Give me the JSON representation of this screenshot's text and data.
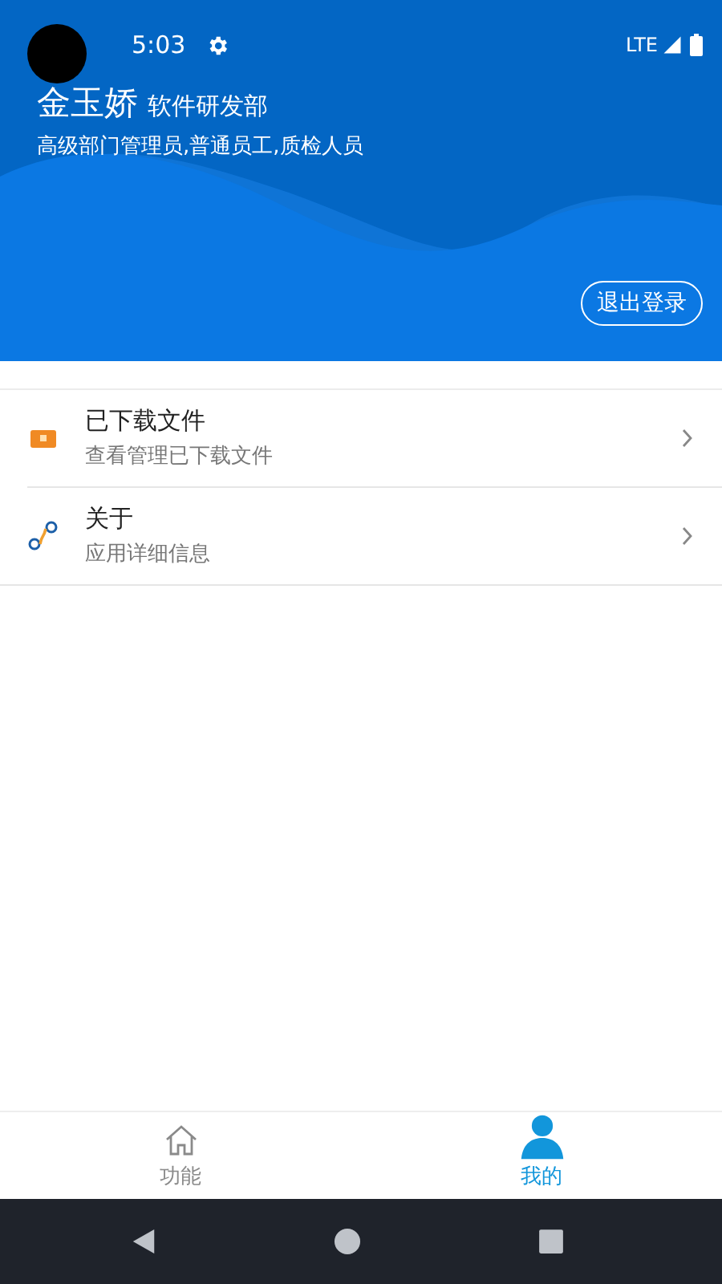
{
  "status_bar": {
    "time": "5:03",
    "network": "LTE"
  },
  "profile": {
    "name": "金玉娇",
    "department": "软件研发部",
    "roles": "高级部门管理员,普通员工,质检人员",
    "logout_button": "退出登录"
  },
  "menu_items": [
    {
      "kind": "downloads",
      "title": "已下载文件",
      "subtitle": "查看管理已下载文件"
    },
    {
      "kind": "about",
      "title": "关于",
      "subtitle": "应用详细信息"
    }
  ],
  "bottom_tabs": [
    {
      "kind": "home",
      "label": "功能",
      "selected": false
    },
    {
      "kind": "profile",
      "label": "我的",
      "selected": true
    }
  ]
}
